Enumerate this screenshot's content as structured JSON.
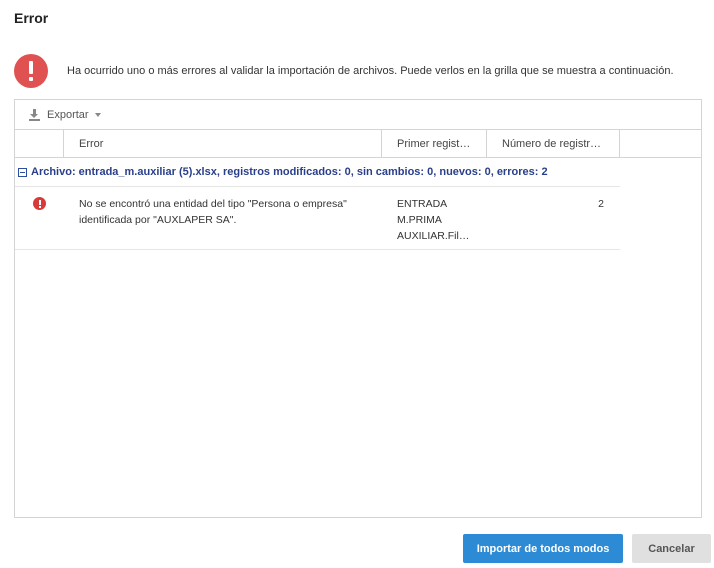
{
  "dialog": {
    "title": "Error"
  },
  "alert": {
    "icon": "exclamation-circle-icon",
    "color": "#e05252",
    "message": "Ha ocurrido uno o más errores al validar la importación de archivos. Puede verlos en la grilla que se muestra a continuación."
  },
  "toolbar": {
    "export_label": "Exportar",
    "export_icon": "download-icon"
  },
  "grid": {
    "columns": [
      "",
      "Error",
      "Primer regist…",
      "Número de registr…"
    ],
    "group_label": "Archivo: entrada_m.auxiliar (5).xlsx, registros modificados: 0, sin cambios: 0, nuevos: 0, errores: 2",
    "rows": [
      {
        "status_icon": "error-icon",
        "message": "No se encontró una entidad del tipo \"Persona o empresa\" identificada por \"AUXLAPER SA\".",
        "first_record": [
          "ENTRADA",
          "M.PRIMA",
          "AUXILIAR.Fil…"
        ],
        "record_number": "2"
      }
    ]
  },
  "buttons": {
    "import_anyway": "Importar de todos modos",
    "cancel": "Cancelar"
  },
  "colors": {
    "primary": "#2d8bd6",
    "group_text": "#2a3f8a",
    "error": "#d83a3a"
  }
}
